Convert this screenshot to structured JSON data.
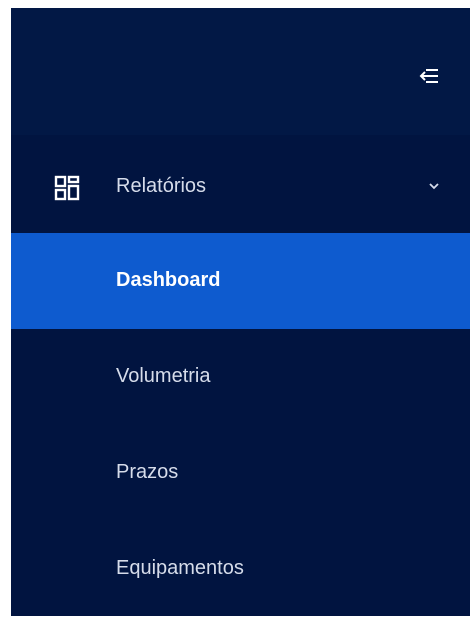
{
  "sidebar": {
    "collapse_icon": "collapse-left-icon",
    "group": {
      "icon": "dashboard-grid-icon",
      "label": "Relatórios",
      "chevron_icon": "chevron-down-icon",
      "expanded": true
    },
    "items": [
      {
        "label": "Dashboard",
        "active": true
      },
      {
        "label": "Volumetria",
        "active": false
      },
      {
        "label": "Prazos",
        "active": false
      },
      {
        "label": "Equipamentos",
        "active": false
      }
    ]
  },
  "colors": {
    "sidebar_bg": "#021845",
    "menu_bg": "#011440",
    "active_bg": "#0e5bcf",
    "text": "#d6dcea",
    "active_text": "#ffffff"
  }
}
